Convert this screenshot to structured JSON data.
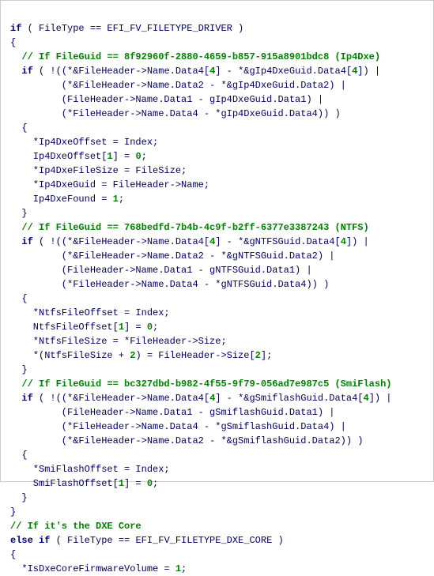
{
  "chart_data": null,
  "code": {
    "l01": {
      "kw": "if",
      "txt": " ( FileType == EFI_FV_FILETYPE_DRIVER )"
    },
    "l02": "{",
    "l03_cm": "  // If FileGuid == 8f92960f-2880-4659-b857-915a8901bdc8 (Ip4Dxe)",
    "l04": {
      "kw": "if",
      "a": " ( !((*&FileHeader->Name.Data4[",
      "n1": "4",
      "b": "] - *&gIp4DxeGuid.Data4[",
      "n2": "4",
      "c": "]) |"
    },
    "l05": "         (*&FileHeader->Name.Data2 - *&gIp4DxeGuid.Data2) |",
    "l06": "         (FileHeader->Name.Data1 - gIp4DxeGuid.Data1) |",
    "l07": "         (*FileHeader->Name.Data4 - *gIp4DxeGuid.Data4)) )",
    "l08": "  {",
    "l09": "    *Ip4DxeOffset = Index;",
    "l10": {
      "a": "    Ip4DxeOffset[",
      "n": "1",
      "b": "] = ",
      "n2": "0",
      "c": ";"
    },
    "l11": "    *Ip4DxeFileSize = FileSize;",
    "l12": "    *Ip4DxeGuid = FileHeader->Name;",
    "l13": {
      "a": "    Ip4DxeFound = ",
      "n": "1",
      "b": ";"
    },
    "l14": "  }",
    "l15_cm": "  // If FileGuid == 768bedfd-7b4b-4c9f-b2ff-6377e3387243 (NTFS)",
    "l16": {
      "kw": "if",
      "a": " ( !((*&FileHeader->Name.Data4[",
      "n1": "4",
      "b": "] - *&gNTFSGuid.Data4[",
      "n2": "4",
      "c": "]) |"
    },
    "l17": "         (*&FileHeader->Name.Data2 - *&gNTFSGuid.Data2) |",
    "l18": "         (FileHeader->Name.Data1 - gNTFSGuid.Data1) |",
    "l19": "         (*FileHeader->Name.Data4 - *gNTFSGuid.Data4)) )",
    "l20": "  {",
    "l21": "    *NtfsFileOffset = Index;",
    "l22": {
      "a": "    NtfsFileOffset[",
      "n": "1",
      "b": "] = ",
      "n2": "0",
      "c": ";"
    },
    "l23": "    *NtfsFileSize = *FileHeader->Size;",
    "l24": {
      "a": "    *(NtfsFileSize + ",
      "n": "2",
      "b": ") = FileHeader->Size[",
      "n2": "2",
      "c": "];"
    },
    "l25": "  }",
    "l26_cm": "  // If FileGuid == bc327dbd-b982-4f55-9f79-056ad7e987c5 (SmiFlash)",
    "l27": {
      "kw": "if",
      "a": " ( !((*&FileHeader->Name.Data4[",
      "n1": "4",
      "b": "] - *&gSmiflashGuid.Data4[",
      "n2": "4",
      "c": "]) |"
    },
    "l28": "         (FileHeader->Name.Data1 - gSmiflashGuid.Data1) |",
    "l29": "         (*FileHeader->Name.Data4 - *gSmiflashGuid.Data4) |",
    "l30": "         (*&FileHeader->Name.Data2 - *&gSmiflashGuid.Data2)) )",
    "l31": "  {",
    "l32": "    *SmiFlashOffset = Index;",
    "l33": {
      "a": "    SmiFlashOffset[",
      "n": "1",
      "b": "] = ",
      "n2": "0",
      "c": ";"
    },
    "l34": "  }",
    "l35": "}",
    "l36_cm": "// If it's the DXE Core",
    "l37": {
      "kw1": "else",
      "kw2": "if",
      "txt": " ( FileType == EFI_FV_FILETYPE_DXE_CORE )"
    },
    "l38": "{",
    "l39": {
      "a": "  *IsDxeCoreFirmwareVolume = ",
      "n": "1",
      "b": ";"
    }
  }
}
